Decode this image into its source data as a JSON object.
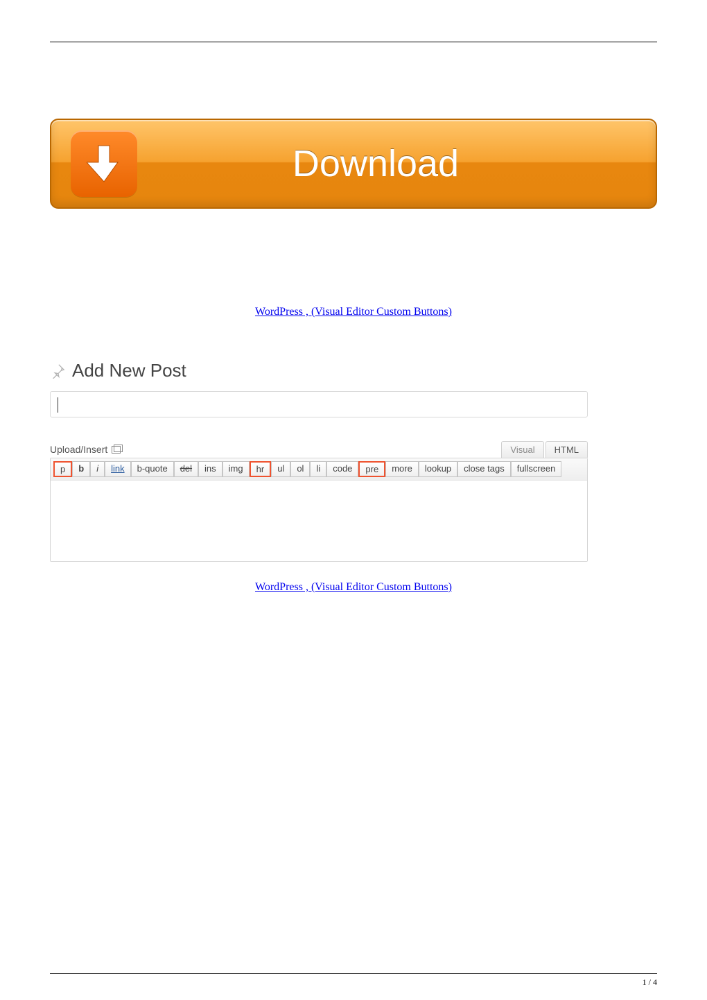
{
  "download": {
    "label": "Download"
  },
  "links": {
    "line1": "WordPress , (Visual Editor Custom Buttons)",
    "line2": "WordPress , (Visual Editor Custom Buttons)"
  },
  "wp": {
    "heading": "Add New Post",
    "title_value": "",
    "upload_insert": "Upload/Insert",
    "tabs": {
      "visual": "Visual",
      "html": "HTML"
    },
    "buttons": [
      {
        "label": "p",
        "style": "hl"
      },
      {
        "label": "b",
        "style": "b"
      },
      {
        "label": "i",
        "style": "i"
      },
      {
        "label": "link",
        "style": "link"
      },
      {
        "label": "b-quote",
        "style": ""
      },
      {
        "label": "del",
        "style": "del"
      },
      {
        "label": "ins",
        "style": ""
      },
      {
        "label": "img",
        "style": ""
      },
      {
        "label": "hr",
        "style": "hl"
      },
      {
        "label": "ul",
        "style": ""
      },
      {
        "label": "ol",
        "style": ""
      },
      {
        "label": "li",
        "style": ""
      },
      {
        "label": "code",
        "style": ""
      },
      {
        "label": "pre",
        "style": "hl"
      },
      {
        "label": "more",
        "style": ""
      },
      {
        "label": "lookup",
        "style": ""
      },
      {
        "label": "close tags",
        "style": ""
      },
      {
        "label": "fullscreen",
        "style": ""
      }
    ]
  },
  "footer": {
    "page": "1 / 4"
  }
}
